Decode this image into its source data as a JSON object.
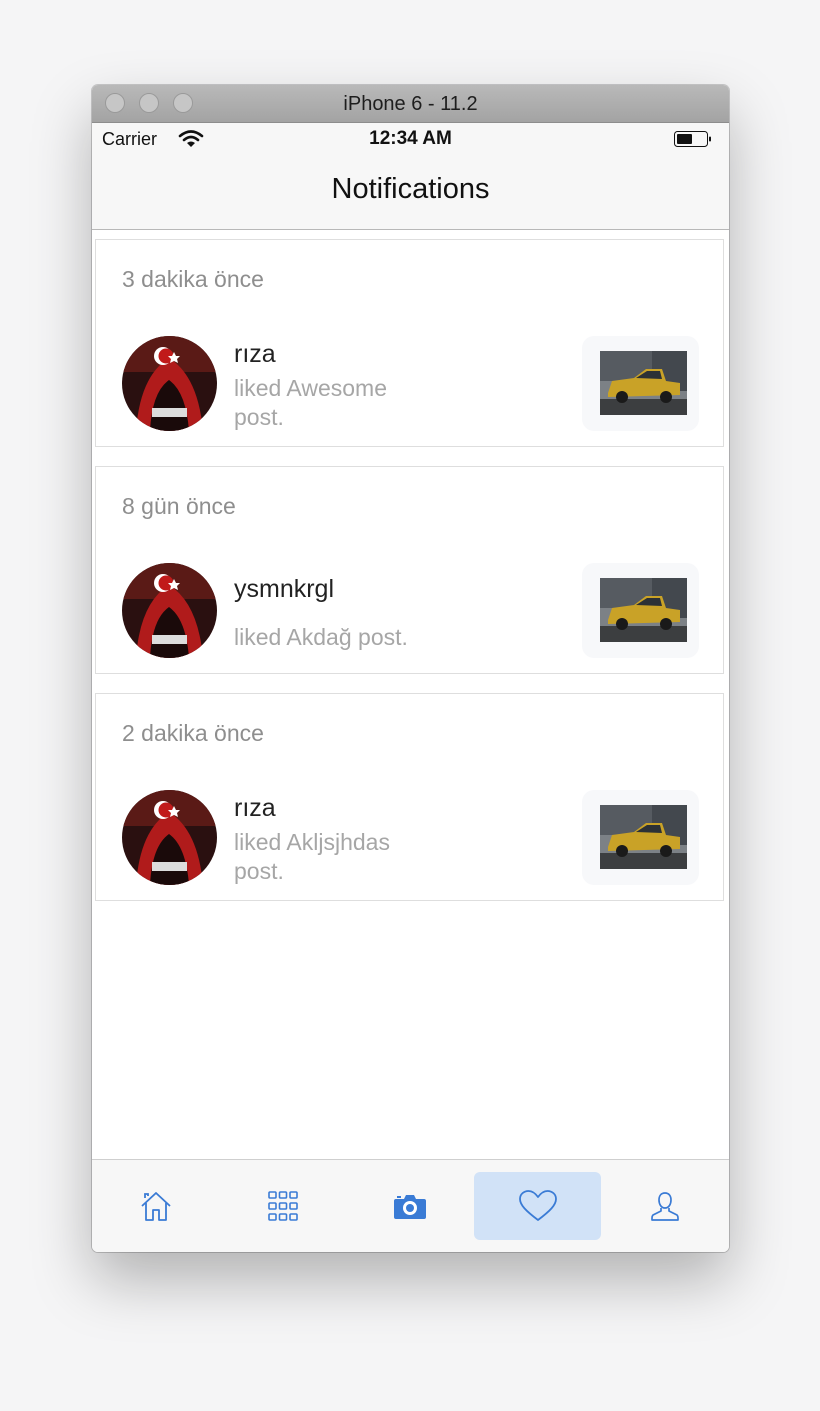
{
  "window": {
    "title": "iPhone 6 - 11.2"
  },
  "status_bar": {
    "carrier": "Carrier",
    "time": "12:34 AM"
  },
  "nav": {
    "title": "Notifications"
  },
  "notifications": [
    {
      "time_ago": "3 dakika önce",
      "username": "rıza",
      "message": "liked Awesome post."
    },
    {
      "time_ago": "8 gün önce",
      "username": "ysmnkrgl",
      "message": "liked Akdağ post."
    },
    {
      "time_ago": "2 dakika önce",
      "username": "rıza",
      "message": "liked Akljsjhdas post."
    }
  ],
  "tab_bar": {
    "tabs": [
      {
        "icon": "home-icon"
      },
      {
        "icon": "grid-icon"
      },
      {
        "icon": "camera-icon"
      },
      {
        "icon": "heart-icon",
        "selected": true
      },
      {
        "icon": "profile-icon"
      }
    ]
  },
  "colors": {
    "accent": "#3a7bd5",
    "selected_tab_bg": "#d1e2f7",
    "secondary_text": "#a6a6a6"
  }
}
